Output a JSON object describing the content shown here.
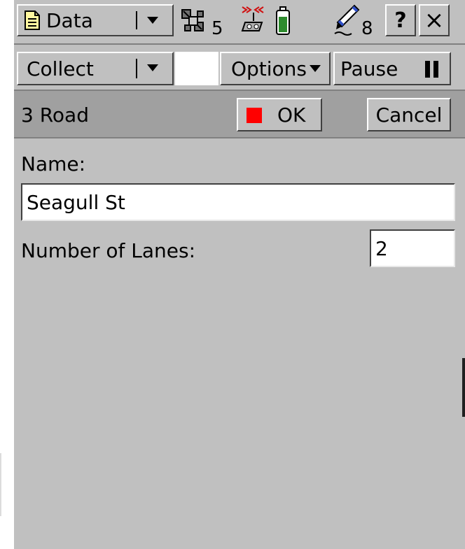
{
  "status_bar": {
    "menu_label": "Data",
    "satellites_count": "5",
    "pen_count": "8",
    "help_label": "?",
    "close_label": "×"
  },
  "toolbar": {
    "mode_label": "Collect",
    "options_label": "Options",
    "pause_label": "Pause"
  },
  "form": {
    "title": "3 Road",
    "ok_label": "OK",
    "cancel_label": "Cancel",
    "ok_indicator_color": "#ff0000"
  },
  "fields": {
    "name_label": "Name:",
    "name_value": "Seagull St",
    "lanes_label": "Number of Lanes:",
    "lanes_value": "2"
  },
  "colors": {
    "background": "#c0c0c0",
    "titlebar": "#a0a0a0",
    "battery": "#2e8b2e"
  }
}
